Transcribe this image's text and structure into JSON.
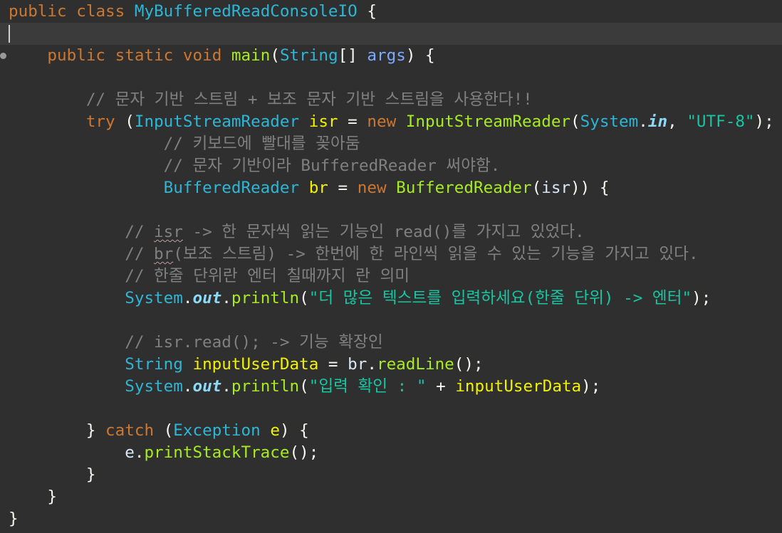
{
  "editor": {
    "language": "java",
    "theme_colors": {
      "background": "#2f2f2f",
      "current_line": "#3b3b3b",
      "keyword": "#cc7832",
      "class_name": "#2eb6d7",
      "string": "#17c6a3",
      "comment": "#808080",
      "method": "#a7ec21",
      "local_variable": "#f2f200",
      "parameter": "#79abff",
      "static_field": "#8dd9f6"
    },
    "tokens": {
      "kw_public": "public",
      "kw_class": "class",
      "kw_static": "static",
      "kw_void": "void",
      "kw_try": "try",
      "kw_new": "new",
      "kw_catch": "catch",
      "class_name": "MyBufferedReadConsoleIO",
      "m_main": "main",
      "t_String": "String",
      "p_args": "args",
      "t_InputStreamReader": "InputStreamReader",
      "v_isr": "isr",
      "t_System": "System",
      "f_in": "in",
      "s_utf8": "\"UTF-8\"",
      "t_BufferedReader": "BufferedReader",
      "v_br": "br",
      "f_out": "out",
      "m_println": "println",
      "v_inputUserData": "inputUserData",
      "m_readLine": "readLine",
      "t_Exception": "Exception",
      "v_e": "e",
      "m_printStackTrace": "printStackTrace",
      "c1": "// 문자 기반 스트림 + 보조 문자 기반 스트림을 사용한다!!",
      "c2": "// 키보드에 빨대를 꽂아둠",
      "c3": "// 문자 기반이라 BufferedReader 써야함.",
      "c4a": "// ",
      "c4b": "isr",
      "c4c": " -> 한 문자씩 읽는 기능인 read()를 가지고 있었다.",
      "c5a": "// ",
      "c5b": "br",
      "c5c": "(보조 스트림) -> 한번에 한 라인씩 읽을 수 있는 기능을 가지고 있다.",
      "c6": "// 한줄 단위란 엔터 칠때까지 란 의미",
      "s_prompt": "\"더 많은 텍스트를 입력하세요(한줄 단위) -> 엔터\"",
      "c7": "// isr.read(); -> 기능 확장인",
      "s_confirm": "\"입력 확인 : \""
    }
  }
}
